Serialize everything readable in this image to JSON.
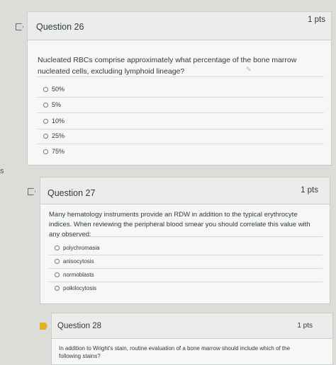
{
  "q26": {
    "title": "Question 26",
    "points": "1 pts",
    "text": "Nucleated RBCs comprise approximately what percentage of the bone marrow nucleated cells, excluding lymphoid lineage?",
    "options": [
      "50%",
      "5%",
      "10%",
      "25%",
      "75%"
    ]
  },
  "q27": {
    "title": "Question 27",
    "points": "1 pts",
    "text": "Many hematology instruments provide an RDW in addition to the typical erythrocyte indices. When reviewing the peripheral blood smear you should correlate this value with any observed:",
    "options": [
      "polychromasia",
      "anisocytosis",
      "normoblasts",
      "poikilocytosis"
    ]
  },
  "q28": {
    "title": "Question 28",
    "points": "1 pts",
    "text": "In addition to Wright's stain, routine evaluation of a bone marrow should include which of the following stains?"
  },
  "page_edge_char": "s",
  "colors": {
    "flag_active": "#e0b21c",
    "text": "#2d3b45"
  },
  "icons": [
    "flag-icon",
    "pencil-icon",
    "radio-icon"
  ]
}
